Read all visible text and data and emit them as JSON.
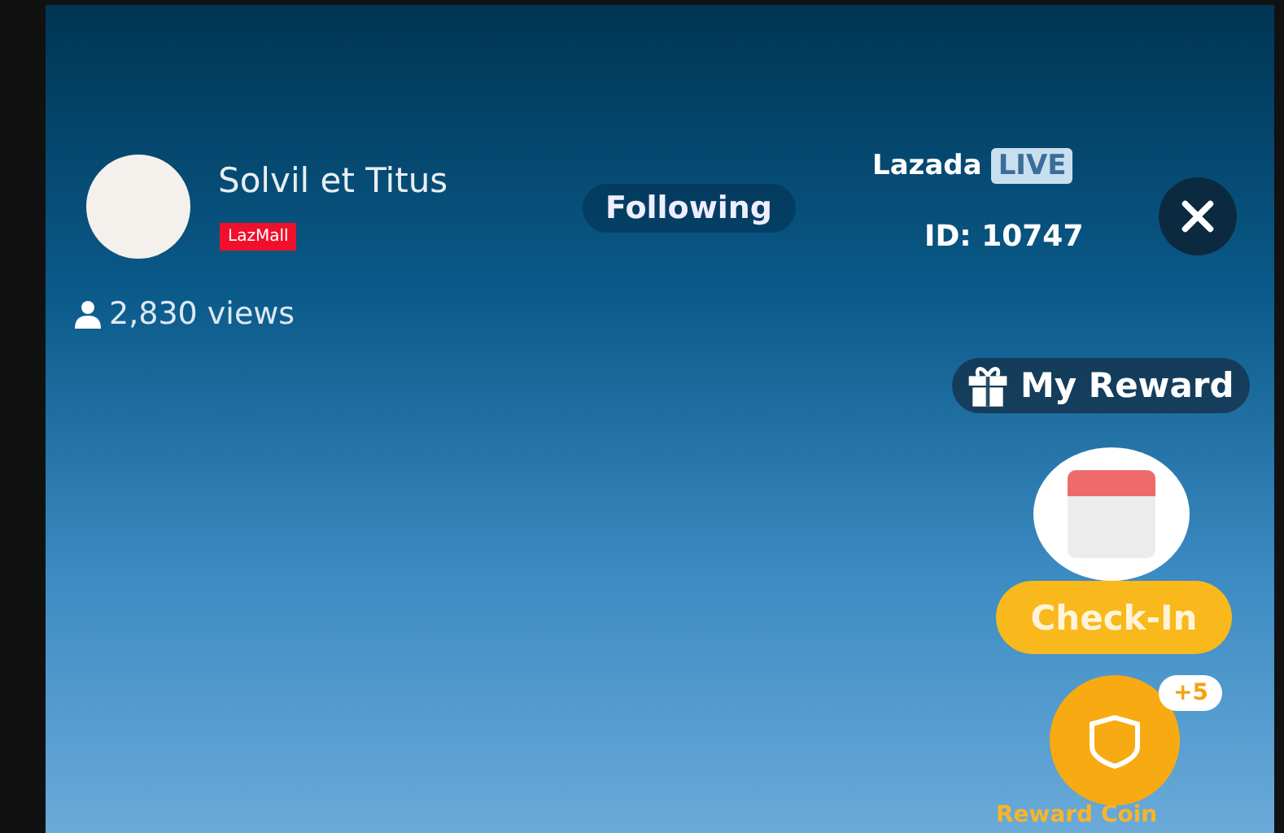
{
  "streamer": {
    "name": "Solvil et Titus",
    "badge": "LazMall",
    "following": "Following",
    "views": "2,830 views"
  },
  "channel": {
    "brand": "Lazada",
    "live": "LIVE",
    "id": "ID: 10747"
  },
  "reward": {
    "label": "My Reward"
  },
  "check_in": {
    "label": "Check-In"
  },
  "coins": {
    "bonus": "+5",
    "label": "Reward Coin"
  }
}
